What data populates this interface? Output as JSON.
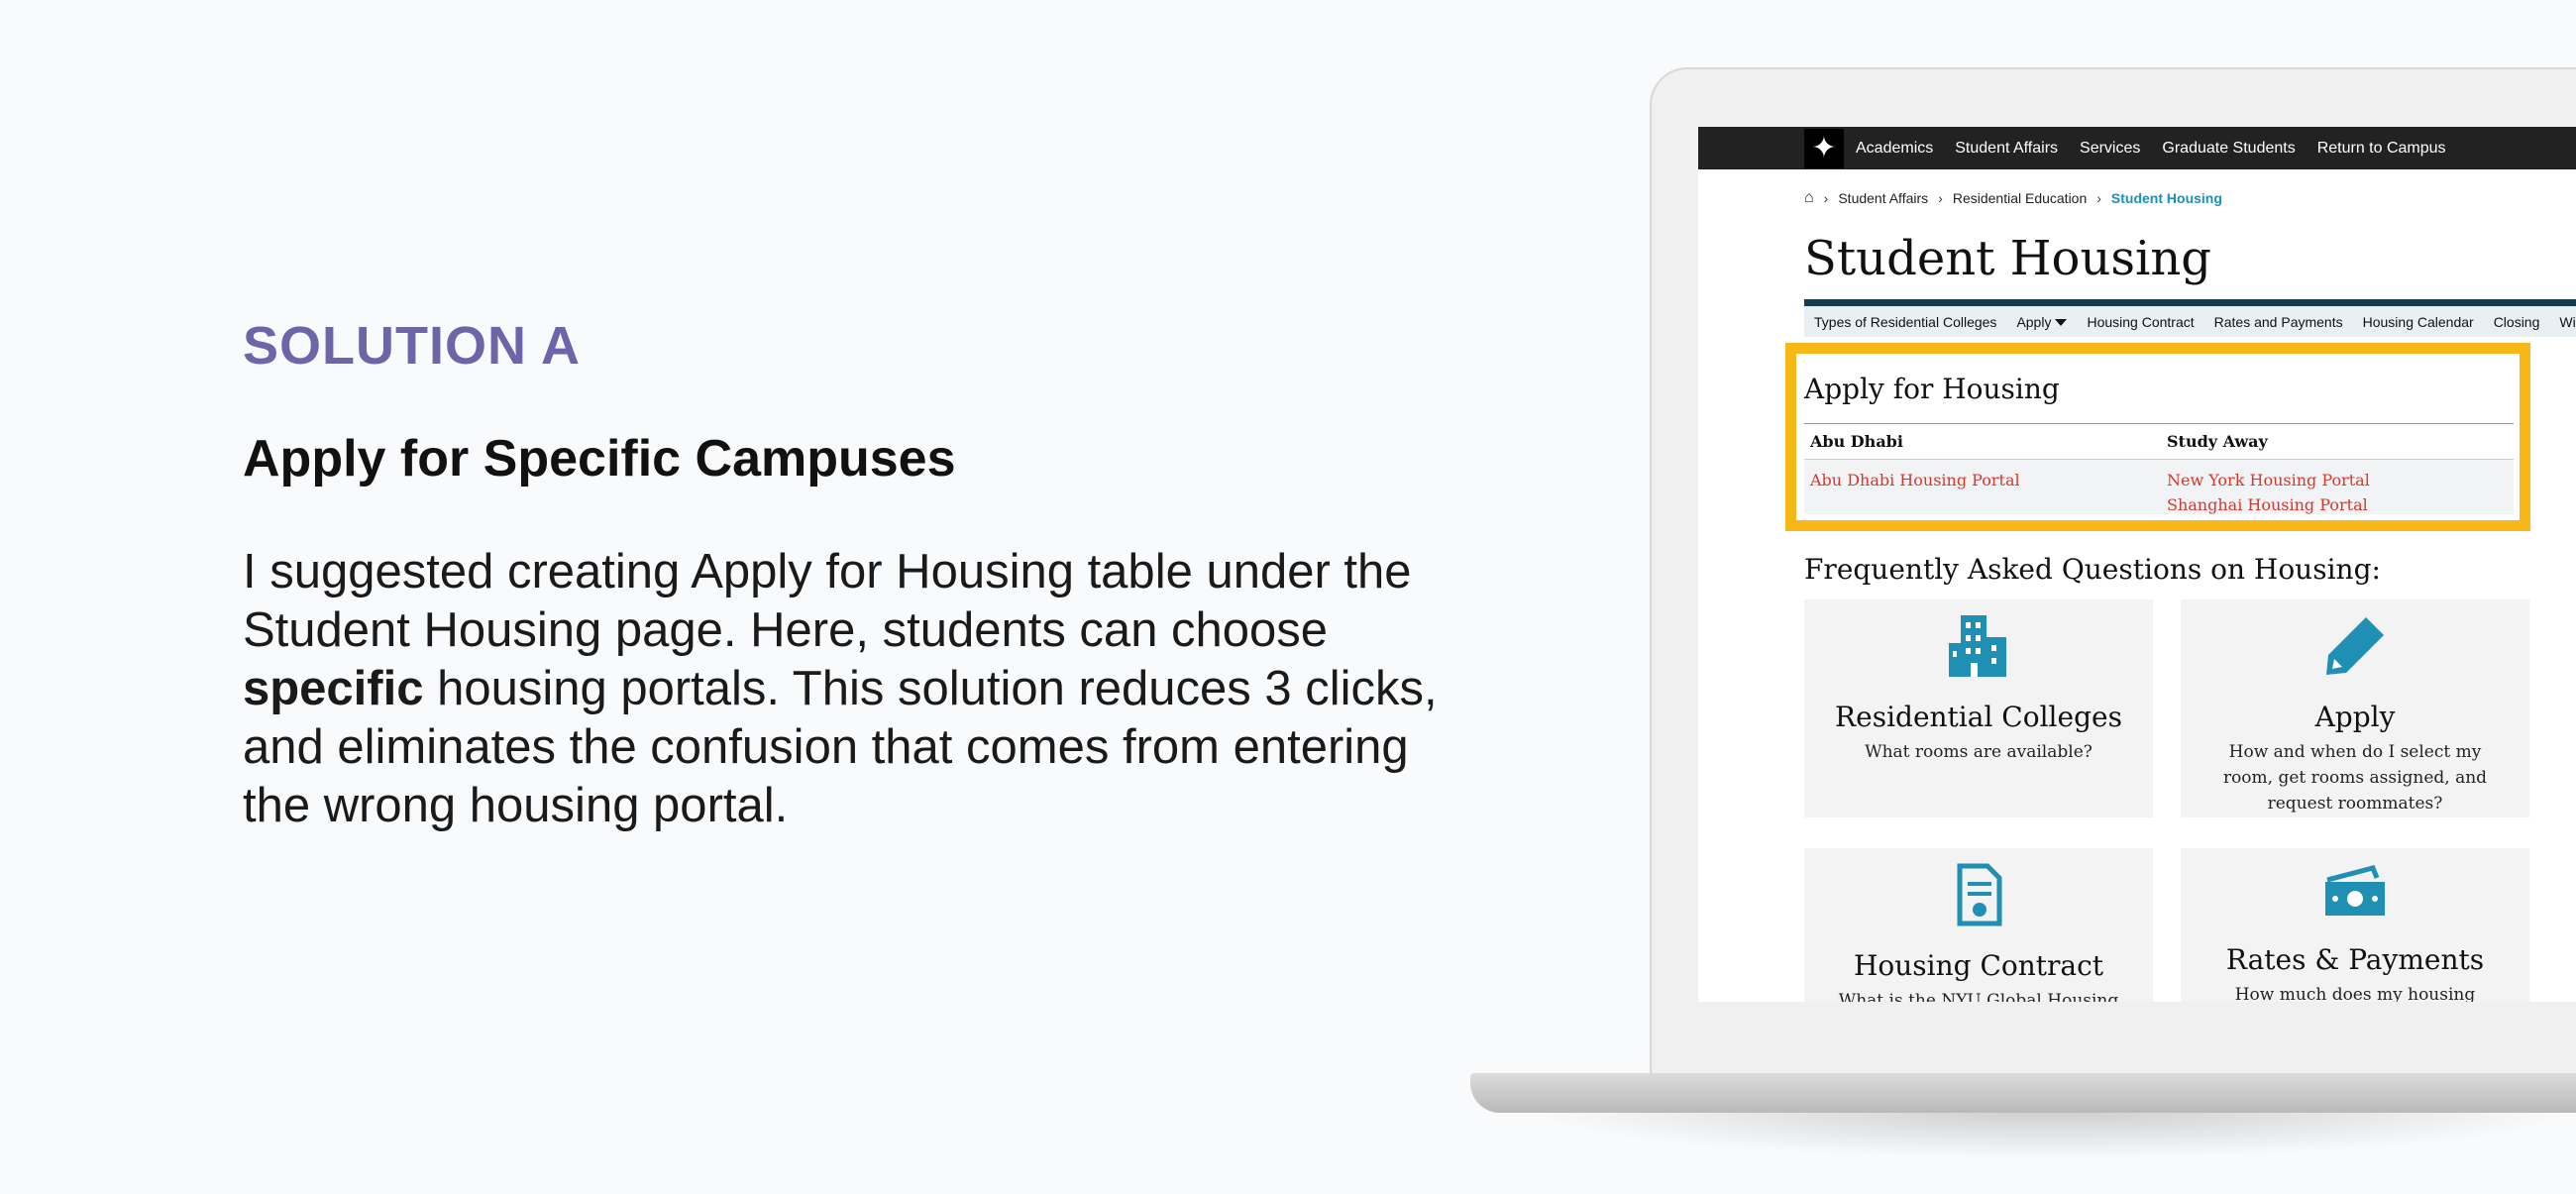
{
  "slide": {
    "label": "SOLUTION A",
    "heading": "Apply for Specific Campuses",
    "body_pre": "I suggested creating Apply for Housing table under the Student Housing page. Here, students can choose ",
    "body_bold": "specific",
    "body_post": " housing portals. This solution reduces 3 clicks, and eliminates the confusion that comes from entering the wrong housing portal."
  },
  "site": {
    "nav": [
      "Academics",
      "Student Affairs",
      "Services",
      "Graduate Students",
      "Return to Campus"
    ],
    "breadcrumb": [
      "Student Affairs",
      "Residential Education",
      "Student Housing"
    ],
    "page_title": "Student Housing",
    "subnav": [
      "Types of Residential Colleges",
      "Apply",
      "Housing Contract",
      "Rates and Payments",
      "Housing Calendar",
      "Closing",
      "Winter H"
    ],
    "apply": {
      "title": "Apply for Housing",
      "col1_header": "Abu Dhabi",
      "col2_header": "Study Away",
      "col1_links": [
        "Abu Dhabi Housing Portal"
      ],
      "col2_links": [
        "New York Housing Portal",
        "Shanghai Housing Portal"
      ]
    },
    "faq_title": "Frequently Asked Questions on Housing:",
    "cards": [
      {
        "icon": "building-icon",
        "title": "Residential Colleges",
        "desc": "What rooms are available?"
      },
      {
        "icon": "pencil-icon",
        "title": "Apply",
        "desc": "How and when do I select my room, get rooms assigned, and request roommates?"
      },
      {
        "icon": "contract-icon",
        "title": "Housing Contract",
        "desc": "What is the NYU Global Housing"
      },
      {
        "icon": "money-icon",
        "title": "Rates & Payments",
        "desc": "How much does my housing cost? How"
      }
    ]
  },
  "colors": {
    "accent_label": "#6c66a8",
    "highlight_border": "#f7b718",
    "link": "#d9352a",
    "breadcrumb_current": "#1f8fb4"
  }
}
